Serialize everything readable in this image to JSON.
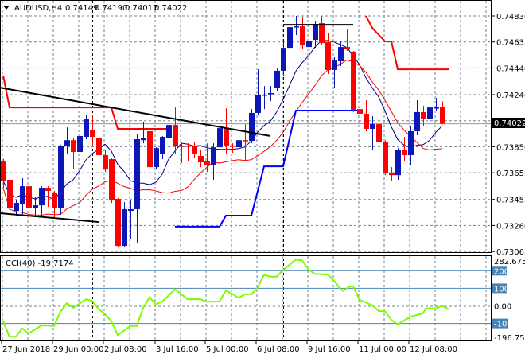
{
  "header": {
    "symbol": "AUDUSD,H4",
    "open": "0.74149",
    "high": "0.74190",
    "low": "0.74017",
    "close": "0.74022"
  },
  "colors": {
    "bull": "#0c17b8",
    "bear": "#ff0000",
    "ma_fast": "#000080",
    "ma_slow": "#ff0000",
    "channel_upper": "#ff0000",
    "channel_lower": "#0000ff",
    "trendline": "#000000",
    "cci": "#7cfc00",
    "cci_levels": "#4682b4",
    "grid": "#708090"
  },
  "price_axis": {
    "labels": [
      "0.74830",
      "0.74635",
      "0.74440",
      "0.74240",
      "0.74045",
      "0.73850",
      "0.73655",
      "0.73455",
      "0.73260",
      "0.73065"
    ],
    "current_price": "0.74022"
  },
  "time_axis": {
    "labels": [
      "27 Jun 2018",
      "29 Jun 00:00",
      "2 Jul 08:00",
      "3 Jul 16:00",
      "5 Jul 00:00",
      "6 Jul 08:00",
      "9 Jul 16:00",
      "11 Jul 00:00",
      "12 Jul 08:00"
    ]
  },
  "cci": {
    "title": "CCI(40) -19.7174",
    "max_label": "282.6753",
    "min_label": "-196.7585",
    "level_labels": [
      "200",
      "100",
      "0.00",
      "-100"
    ],
    "levels": [
      200,
      100,
      -100
    ],
    "range": [
      -196.7585,
      282.6753
    ],
    "values": [
      [
        0,
        -88
      ],
      [
        1,
        -175
      ],
      [
        2,
        -175
      ],
      [
        3,
        -128
      ],
      [
        4,
        -157
      ],
      [
        5,
        -134
      ],
      [
        6,
        -111
      ],
      [
        8,
        -114
      ],
      [
        9,
        -34
      ],
      [
        10,
        15
      ],
      [
        11,
        -11
      ],
      [
        13,
        37
      ],
      [
        14,
        28
      ],
      [
        15,
        -18
      ],
      [
        16,
        -46
      ],
      [
        17,
        -88
      ],
      [
        18,
        -165
      ],
      [
        20,
        -114
      ],
      [
        21,
        -114
      ],
      [
        22,
        -11
      ],
      [
        23,
        49
      ],
      [
        24,
        9
      ],
      [
        25,
        25
      ],
      [
        27,
        94
      ],
      [
        29,
        38
      ],
      [
        31,
        38
      ],
      [
        32,
        23
      ],
      [
        34,
        25
      ],
      [
        35,
        89
      ],
      [
        37,
        46
      ],
      [
        38,
        66
      ],
      [
        39,
        66
      ],
      [
        40,
        105
      ],
      [
        41,
        177
      ],
      [
        42,
        166
      ],
      [
        43,
        166
      ],
      [
        44,
        205
      ],
      [
        46,
        263
      ],
      [
        47,
        258
      ],
      [
        48,
        205
      ],
      [
        49,
        182
      ],
      [
        51,
        178
      ],
      [
        52,
        143
      ],
      [
        53,
        97
      ],
      [
        53.4,
        86
      ],
      [
        54.5,
        111
      ],
      [
        55,
        111
      ],
      [
        56,
        35
      ],
      [
        58,
        3
      ],
      [
        59,
        -29
      ],
      [
        60,
        -31
      ],
      [
        61,
        -80
      ],
      [
        62,
        -106
      ],
      [
        63,
        -83
      ],
      [
        64,
        -62
      ],
      [
        66,
        -42
      ],
      [
        66.4,
        -14
      ],
      [
        68,
        -14
      ],
      [
        69,
        0
      ],
      [
        70,
        -19.7174
      ]
    ]
  },
  "chart_data": {
    "type": "candlestick",
    "title": "AUDUSD,H4",
    "ylim": [
      0.73065,
      0.7483
    ],
    "ohlc": [
      [
        0.73739,
        0.73757,
        0.73542,
        0.73596
      ],
      [
        0.73602,
        0.73608,
        0.73221,
        0.73388
      ],
      [
        0.7337,
        0.73447,
        0.73328,
        0.73429
      ],
      [
        0.73423,
        0.73614,
        0.7334,
        0.73554
      ],
      [
        0.73554,
        0.73566,
        0.7328,
        0.73388
      ],
      [
        0.73388,
        0.73477,
        0.73322,
        0.73411
      ],
      [
        0.73411,
        0.73554,
        0.73328,
        0.73542
      ],
      [
        0.73542,
        0.73554,
        0.73399,
        0.73519
      ],
      [
        0.73501,
        0.73519,
        0.73322,
        0.73388
      ],
      [
        0.73393,
        0.73864,
        0.7334,
        0.73858
      ],
      [
        0.73858,
        0.73995,
        0.73799,
        0.73899
      ],
      [
        0.73899,
        0.73912,
        0.7368,
        0.73811
      ],
      [
        0.73811,
        0.74013,
        0.73793,
        0.7393
      ],
      [
        0.73924,
        0.74085,
        0.73906,
        0.74055
      ],
      [
        0.73972,
        0.74085,
        0.73858,
        0.73924
      ],
      [
        0.73918,
        0.73948,
        0.73637,
        0.73787
      ],
      [
        0.73787,
        0.73828,
        0.73662,
        0.73685
      ],
      [
        0.73757,
        0.73763,
        0.73429,
        0.73447
      ],
      [
        0.73459,
        0.73465,
        0.73096,
        0.73107
      ],
      [
        0.73107,
        0.73435,
        0.73096,
        0.73382
      ],
      [
        0.7337,
        0.73447,
        0.73161,
        0.73382
      ],
      [
        0.73382,
        0.73948,
        0.73131,
        0.73906
      ],
      [
        0.73899,
        0.74037,
        0.73876,
        0.73918
      ],
      [
        0.73966,
        0.73972,
        0.73685,
        0.73697
      ],
      [
        0.73697,
        0.73846,
        0.73685,
        0.7384
      ],
      [
        0.73799,
        0.7393,
        0.73757,
        0.73924
      ],
      [
        0.73918,
        0.7424,
        0.73817,
        0.74013
      ],
      [
        0.74013,
        0.74144,
        0.73799,
        0.73858
      ],
      [
        0.73858,
        0.73888,
        0.73727,
        0.73852
      ],
      [
        0.73858,
        0.73876,
        0.73739,
        0.73852
      ],
      [
        0.73858,
        0.73888,
        0.73769,
        0.73799
      ],
      [
        0.73781,
        0.73828,
        0.73697,
        0.73733
      ],
      [
        0.73739,
        0.73876,
        0.73662,
        0.73715
      ],
      [
        0.73715,
        0.73876,
        0.73602,
        0.73846
      ],
      [
        0.73846,
        0.74073,
        0.73787,
        0.73989
      ],
      [
        0.73989,
        0.74138,
        0.73793,
        0.73858
      ],
      [
        0.73858,
        0.73876,
        0.73805,
        0.73852
      ],
      [
        0.73846,
        0.73918,
        0.73834,
        0.73899
      ],
      [
        0.73899,
        0.74019,
        0.73745,
        0.73894
      ],
      [
        0.73894,
        0.74132,
        0.73876,
        0.74103
      ],
      [
        0.74103,
        0.7443,
        0.74085,
        0.74234
      ],
      [
        0.74234,
        0.74305,
        0.74132,
        0.7424
      ],
      [
        0.74246,
        0.74305,
        0.74192,
        0.74252
      ],
      [
        0.74293,
        0.74436,
        0.7427,
        0.74419
      ],
      [
        0.74419,
        0.74639,
        0.74383,
        0.74591
      ],
      [
        0.74591,
        0.74794,
        0.74579,
        0.74746
      ],
      [
        0.74746,
        0.7483,
        0.74687,
        0.74752
      ],
      [
        0.74752,
        0.74824,
        0.74585,
        0.74609
      ],
      [
        0.74597,
        0.7474,
        0.74579,
        0.74645
      ],
      [
        0.74651,
        0.74794,
        0.74591,
        0.7477
      ],
      [
        0.74776,
        0.7483,
        0.74615,
        0.74627
      ],
      [
        0.74633,
        0.74699,
        0.74395,
        0.74425
      ],
      [
        0.74425,
        0.7452,
        0.74293,
        0.74496
      ],
      [
        0.7449,
        0.74639,
        0.74454,
        0.74597
      ],
      [
        0.74597,
        0.74728,
        0.74568,
        0.74579
      ],
      [
        0.74562,
        0.74568,
        0.74109,
        0.74127
      ],
      [
        0.74132,
        0.74281,
        0.74043,
        0.74097
      ],
      [
        0.74097,
        0.74198,
        0.73966,
        0.73984
      ],
      [
        0.73984,
        0.74079,
        0.73823,
        0.74019
      ],
      [
        0.74019,
        0.74144,
        0.73876,
        0.73888
      ],
      [
        0.73888,
        0.73899,
        0.73637,
        0.73656
      ],
      [
        0.73656,
        0.73697,
        0.7359,
        0.73637
      ],
      [
        0.73637,
        0.7384,
        0.73602,
        0.73823
      ],
      [
        0.73823,
        0.73924,
        0.73739,
        0.73787
      ],
      [
        0.73787,
        0.74007,
        0.73709,
        0.73966
      ],
      [
        0.73966,
        0.74198,
        0.73936,
        0.74109
      ],
      [
        0.74109,
        0.74156,
        0.74007,
        0.74061
      ],
      [
        0.74055,
        0.74204,
        0.73978,
        0.74144
      ],
      [
        0.74138,
        0.74216,
        0.74115,
        0.74144
      ],
      [
        0.74149,
        0.7419,
        0.74017,
        0.74022
      ]
    ],
    "channel_upper": [
      [
        [
          0,
          0.74383
        ],
        [
          1,
          0.74144
        ],
        [
          17,
          0.74144
        ],
        [
          18,
          0.73984
        ],
        [
          26,
          0.73984
        ]
      ],
      [
        [
          57,
          0.7483
        ],
        [
          58,
          0.7474
        ],
        [
          60,
          0.74639
        ],
        [
          61,
          0.74639
        ],
        [
          62,
          0.7443
        ],
        [
          70,
          0.7443
        ]
      ]
    ],
    "channel_lower": [
      [
        27,
        0.73251
      ],
      [
        34,
        0.73251
      ],
      [
        35,
        0.73334
      ],
      [
        39,
        0.73334
      ],
      [
        41,
        0.73703
      ],
      [
        44,
        0.73703
      ],
      [
        46,
        0.74121
      ],
      [
        56,
        0.74121
      ]
    ],
    "trendlines": [
      [
        [
          -0.5,
          0.74293
        ],
        [
          42,
          0.7393
        ]
      ],
      [
        [
          -0.5,
          0.73352
        ],
        [
          15,
          0.73286
        ]
      ],
      [
        [
          44,
          0.74764
        ],
        [
          55,
          0.74764
        ]
      ]
    ],
    "period_separators": [
      14,
      44
    ]
  }
}
